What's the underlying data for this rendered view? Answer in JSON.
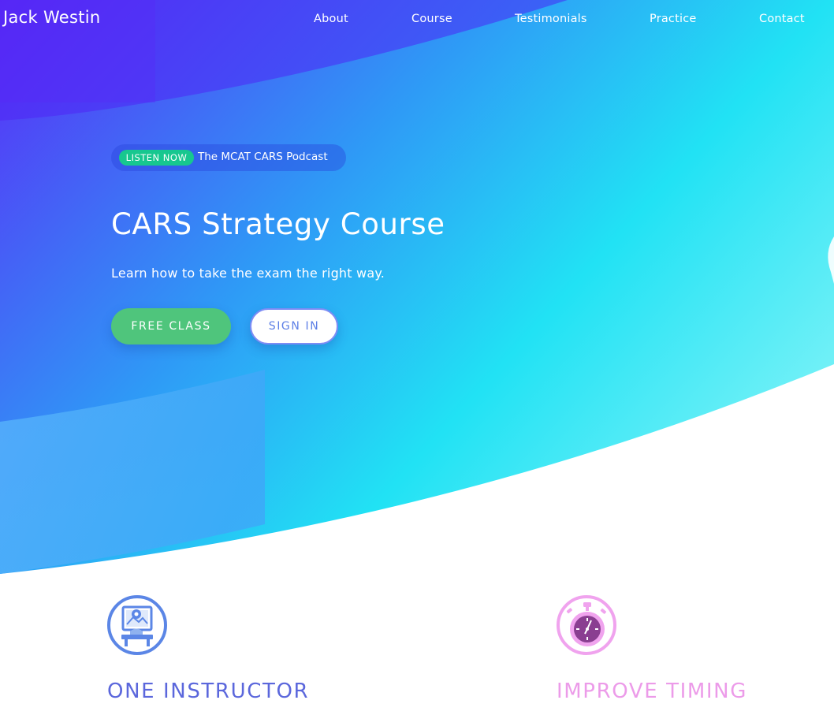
{
  "nav": {
    "brand": "Jack Westin",
    "links": [
      "About",
      "Course",
      "Testimonials",
      "Practice",
      "Contact"
    ]
  },
  "hero": {
    "podcast_badge": "LISTEN NOW",
    "podcast_text": "The MCAT CARS Podcast",
    "title": "CARS Strategy Course",
    "subtitle": "Learn how to take the exam the right way.",
    "primary_button": "FREE CLASS",
    "secondary_button": "SIGN IN"
  },
  "features": [
    {
      "title": "ONE INSTRUCTOR",
      "icon": "instructor-icon",
      "color": "#5b67dc"
    },
    {
      "title": "IMPROVE TIMING",
      "icon": "stopwatch-icon",
      "color": "#ec9be9"
    }
  ],
  "colors": {
    "gradient_start": "#5a2bf7",
    "gradient_mid": "#2f98f6",
    "gradient_end": "#21e2f4",
    "badge_green": "#17c78f",
    "button_green": "#4fc57c",
    "sign_in_text": "#5d7fe6"
  }
}
